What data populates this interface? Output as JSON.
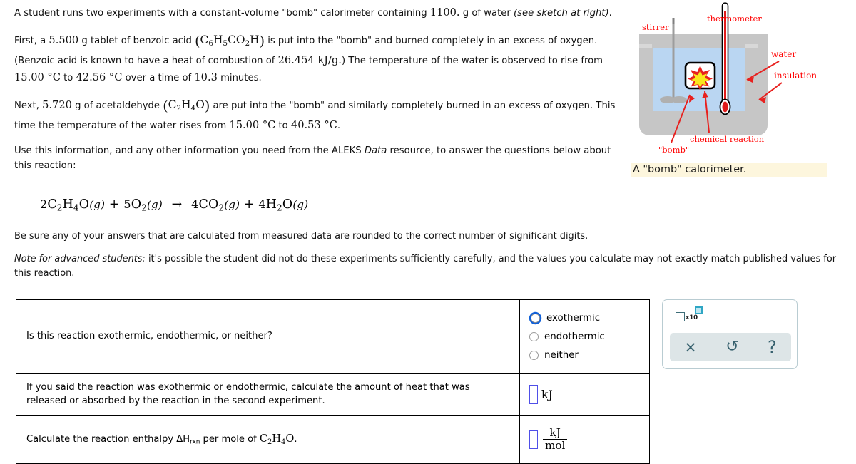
{
  "problem": {
    "p1_a": "A student runs two experiments with a constant-volume \"bomb\" calorimeter containing ",
    "p1_water_mass": "1100.",
    "p1_b": " g of water ",
    "p1_see_sketch": "(see sketch at right)",
    "p1_c": ".",
    "p2_a": "First, a ",
    "p2_tablet_mass": "5.500",
    "p2_b": " g tablet of benzoic acid ",
    "p2_formula": "C6H5CO2H",
    "p2_c": " is put into the \"bomb\" and burned completely in an excess of oxygen. (Benzoic acid is known to have a heat of combustion of ",
    "p2_heat_of_combustion": "26.454 kJ/g.",
    "p2_d": ") The temperature of the water is observed to rise from ",
    "p2_t_initial": "15.00 °C",
    "p2_e": " to ",
    "p2_t_final": "42.56 °C",
    "p2_f": " over a time of ",
    "p2_time": "10.3",
    "p2_g": " minutes.",
    "p3_a": "Next, ",
    "p3_mass": "5.720",
    "p3_b": " g of acetaldehyde ",
    "p3_formula": "C2H4O",
    "p3_c": " are put into the \"bomb\" and similarly completely burned in an excess of oxygen. This time the temperature of the water rises from ",
    "p3_t_initial": "15.00 °C",
    "p3_d": " to ",
    "p3_t_final": "40.53 °C",
    "p3_e": ".",
    "p4_a": "Use this information, and any other information you need from the ALEKS ",
    "p4_data": "Data",
    "p4_b": " resource, to answer the questions below about this reaction:",
    "note_sigfigs": "Be sure any of your answers that are calculated from measured data are rounded to the correct number of significant digits.",
    "note_adv_label": "Note for advanced students:",
    "note_adv_text": " it's possible the student did not do these experiments sufficiently carefully, and the values you calculate may not exactly match published values for this reaction."
  },
  "equation": {
    "r1_coef": "2",
    "r1_formula": "C2H4O",
    "r1_state": "(g)",
    "plus1": "+",
    "r2_coef": "5",
    "r2_formula": "O2",
    "r2_state": "(g)",
    "arrow": "→",
    "p1_coef": "4",
    "p1_formula": "CO2",
    "p1_state": "(g)",
    "plus2": "+",
    "p2_coef": "4",
    "p2_formula": "H2O",
    "p2_state": "(g)"
  },
  "figure": {
    "caption": "A \"bomb\" calorimeter.",
    "labels": {
      "stirrer": "stirrer",
      "thermometer": "thermometer",
      "water": "water",
      "insulation": "insulation",
      "bomb": "\"bomb\"",
      "chemical_reaction": "chemical reaction"
    },
    "colors": {
      "insulation": "#c6c6c6",
      "water": "#bad6f2",
      "label_red": "#ff0000",
      "arrow_red": "#e8201e",
      "flame_outer": "#e8201e",
      "flame_inner": "#f9e71c",
      "caption_bg": "#fdf6dd"
    }
  },
  "table": {
    "rows": [
      {
        "question": "Is this reaction exothermic, endothermic, or neither?",
        "answer_type": "radio",
        "options": [
          "exothermic",
          "endothermic",
          "neither"
        ],
        "focused_option": "exothermic"
      },
      {
        "question": "If you said the reaction was exothermic or endothermic, calculate the amount of heat that was released or absorbed by the reaction in the second experiment.",
        "answer_type": "input",
        "value": "",
        "unit": "kJ"
      },
      {
        "question_a": "Calculate the reaction enthalpy ΔH",
        "question_sub": "rxn",
        "question_b": " per mole of ",
        "question_formula": "C2H4O",
        "question_c": ".",
        "answer_type": "input-fraction",
        "value": "",
        "unit_numerator": "kJ",
        "unit_denominator": "mol"
      }
    ]
  },
  "toolbar": {
    "sci_notation_label": "x10",
    "clear_icon": "×",
    "undo_icon": "↺",
    "help_icon": "?",
    "accent": "#36606d",
    "bar_bg": "#dde5e7"
  }
}
